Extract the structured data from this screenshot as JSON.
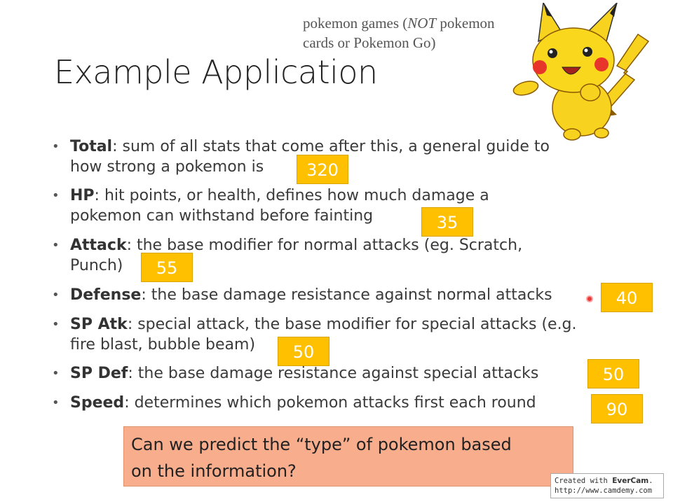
{
  "note": {
    "line1_pre": "pokemon games (",
    "line1_em": "NOT",
    "line1_post": " pokemon",
    "line2": "cards or Pokemon Go)"
  },
  "title": "Example Application",
  "stats": [
    {
      "term": "Total",
      "desc_l1": ": sum of all stats that come after this, a general guide to",
      "desc_l2": "how strong a pokemon is",
      "value": "320"
    },
    {
      "term": "HP",
      "desc_l1": ": hit points, or health, defines how much damage a",
      "desc_l2": "pokemon can withstand before fainting",
      "value": "35"
    },
    {
      "term": "Attack",
      "desc_l1": ": the base modifier for normal attacks (eg. Scratch,",
      "desc_l2": "Punch)",
      "value": "55"
    },
    {
      "term": "Defense",
      "desc_l1": ": the base damage resistance against normal attacks",
      "desc_l2": "",
      "value": "40"
    },
    {
      "term": "SP Atk",
      "desc_l1": ": special attack, the base modifier for special attacks (e.g.",
      "desc_l2": "fire blast, bubble beam)",
      "value": "50"
    },
    {
      "term": "SP Def",
      "desc_l1": ": the base damage resistance against special attacks",
      "desc_l2": "",
      "value": "50"
    },
    {
      "term": "Speed",
      "desc_l1": ": determines which pokemon attacks first each round",
      "desc_l2": "",
      "value": "90"
    }
  ],
  "question": {
    "line1": "Can we predict the “type” of pokemon based",
    "line2": "on the information?"
  },
  "watermark": {
    "created_with": "Created with ",
    "brand": "EverCam",
    "dot": ".",
    "url": "http://www.camdemy.com"
  },
  "colors": {
    "value_box": "#ffc000",
    "question_box": "#f8ad8d"
  },
  "icons": {
    "pikachu": "pikachu-image",
    "cursor": "cursor-pointer-icon"
  }
}
